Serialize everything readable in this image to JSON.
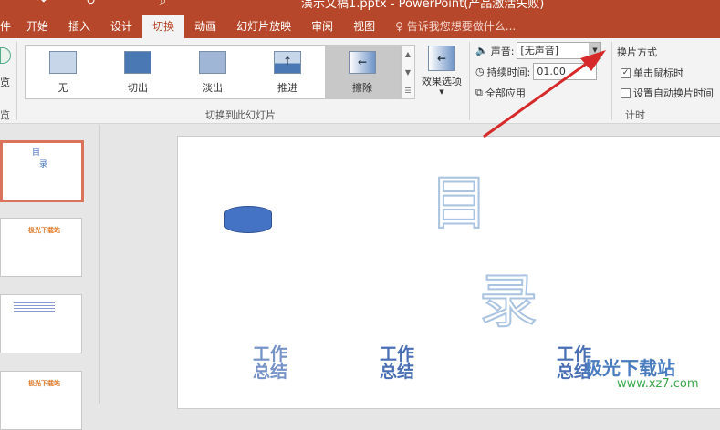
{
  "window": {
    "title": "演示文稿1.pptx - PowerPoint(产品激活失败)"
  },
  "tabs": [
    {
      "label": "件"
    },
    {
      "label": "开始"
    },
    {
      "label": "插入"
    },
    {
      "label": "设计"
    },
    {
      "label": "切换",
      "active": true
    },
    {
      "label": "动画"
    },
    {
      "label": "幻灯片放映"
    },
    {
      "label": "审阅"
    },
    {
      "label": "视图"
    }
  ],
  "tell_me": "告诉我您想要做什么...",
  "preview": {
    "label": "览",
    "group": "览"
  },
  "transitions": {
    "items": [
      {
        "label": "无"
      },
      {
        "label": "切出"
      },
      {
        "label": "淡出"
      },
      {
        "label": "推进"
      },
      {
        "label": "擦除",
        "selected": true
      }
    ],
    "effect_options": "效果选项",
    "group_label": "切换到此幻灯片"
  },
  "timing": {
    "sound_label": "声音:",
    "sound_value": "[无声音]",
    "duration_label": "持续时间:",
    "duration_value": "01.00",
    "apply_all": "全部应用",
    "advance_label": "换片方式",
    "on_click": "单击鼠标时",
    "on_click_checked": true,
    "auto_after": "设置自动换片时间",
    "auto_checked": false,
    "group_label": "计时"
  },
  "slide": {
    "char1": "目",
    "char2": "录",
    "items": [
      "工作总结",
      "工作总结",
      "工作总结"
    ]
  },
  "thumbnails": {
    "slide2_title": "极光下载站",
    "slide4_title": "极光下载站"
  },
  "watermark": {
    "name": "极光下载站",
    "url": "www.xz7.com"
  },
  "colors": {
    "accent": "#b7472a",
    "selection": "#d9735a",
    "arrow": "#d62a2a"
  }
}
